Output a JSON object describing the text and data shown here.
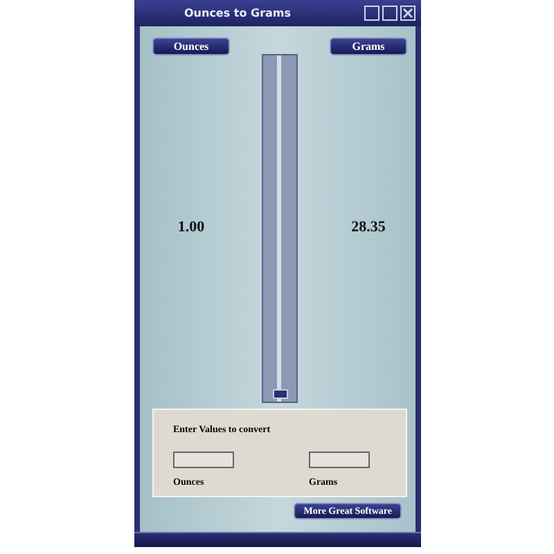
{
  "window": {
    "title": "Ounces to Grams"
  },
  "unit_buttons": [
    {
      "label": "Ounces"
    },
    {
      "label": "Grams"
    }
  ],
  "readouts": [
    "1.00",
    "28.35"
  ],
  "slider": {
    "level": 0.0
  },
  "input_panel": {
    "heading": "Enter Values to convert",
    "fields": [
      {
        "label": "Ounces"
      },
      {
        "label": "Grams"
      }
    ]
  },
  "footer_button": {
    "label": "More Great Software"
  }
}
